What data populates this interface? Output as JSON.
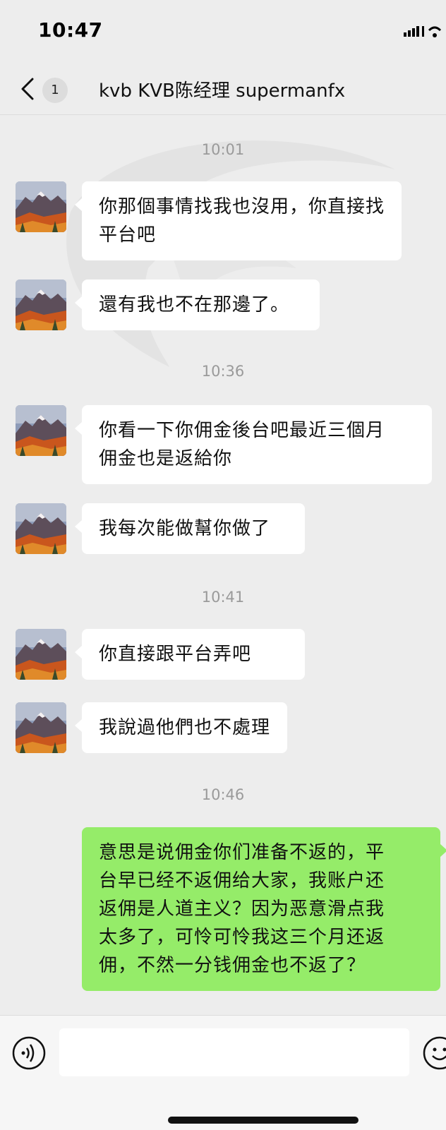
{
  "status": {
    "time": "10:47"
  },
  "header": {
    "unread_count": "1",
    "title": "kvb KVB陈经理 supermanfx"
  },
  "messages": [
    {
      "kind": "time",
      "text": "10:01"
    },
    {
      "kind": "in",
      "lines": [
        "你那個事情找我也沒用，你直接找",
        "平台吧"
      ]
    },
    {
      "kind": "in",
      "lines": [
        "還有我也不在那邊了。"
      ]
    },
    {
      "kind": "time",
      "text": "10:36"
    },
    {
      "kind": "in",
      "lines": [
        "你看一下你佣金後台吧最近三個月",
        "佣金也是返給你"
      ]
    },
    {
      "kind": "in",
      "lines": [
        "我每次能做幫你做了"
      ]
    },
    {
      "kind": "time",
      "text": "10:41"
    },
    {
      "kind": "in",
      "lines": [
        "你直接跟平台弄吧"
      ]
    },
    {
      "kind": "in",
      "lines": [
        "我說過他們也不處理"
      ]
    },
    {
      "kind": "time",
      "text": "10:46"
    },
    {
      "kind": "out",
      "lines": [
        "意思是说佣金你们准备不返的，平",
        "台早已经不返佣给大家，我账户还",
        "返佣是人道主义？因为恶意滑点我",
        "太多了，可怜可怜我这三个月还返",
        "佣，不然一分钱佣金也不返了？"
      ]
    }
  ],
  "input": {
    "value": ""
  },
  "colors": {
    "background": "#ededed",
    "incoming_bubble": "#ffffff",
    "outgoing_bubble": "#95ec69"
  }
}
